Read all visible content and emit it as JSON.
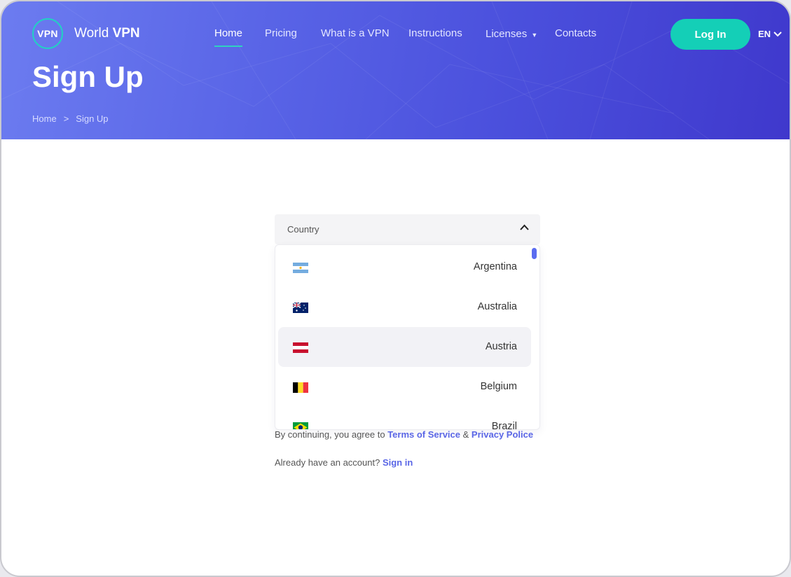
{
  "brand": {
    "badge": "VPN",
    "name_regular": "World",
    "name_bold": "VPN"
  },
  "nav": {
    "items": [
      {
        "label": "Home",
        "active": true
      },
      {
        "label": "Pricing"
      },
      {
        "label": "What is a VPN"
      },
      {
        "label": "Instructions"
      },
      {
        "label": "Licenses"
      },
      {
        "label": "Contacts"
      }
    ]
  },
  "header": {
    "login_label": "Log In",
    "language": "EN"
  },
  "page": {
    "title": "Sign Up"
  },
  "breadcrumb": {
    "home": "Home",
    "separator": ">",
    "current": "Sign Up"
  },
  "form": {
    "country_placeholder": "Country",
    "countries": [
      {
        "name": "Argentina",
        "flag": "argentina-flag-icon"
      },
      {
        "name": "Australia",
        "flag": "australia-flag-icon"
      },
      {
        "name": "Austria",
        "flag": "austria-flag-icon",
        "highlighted": true
      },
      {
        "name": "Belgium",
        "flag": "belgium-flag-icon"
      },
      {
        "name": "Brazil",
        "flag": "brazil-flag-icon"
      }
    ],
    "terms_prefix": "By continuing, you agree to",
    "terms_link": "Terms of Service",
    "terms_amp": "&",
    "privacy_link": "Privacy Police",
    "account_prefix": "Already have an account?",
    "signin_link": "Sign in"
  },
  "colors": {
    "accent": "#14cfb7",
    "primary": "#4a4fdc",
    "link": "#5a66e6"
  }
}
